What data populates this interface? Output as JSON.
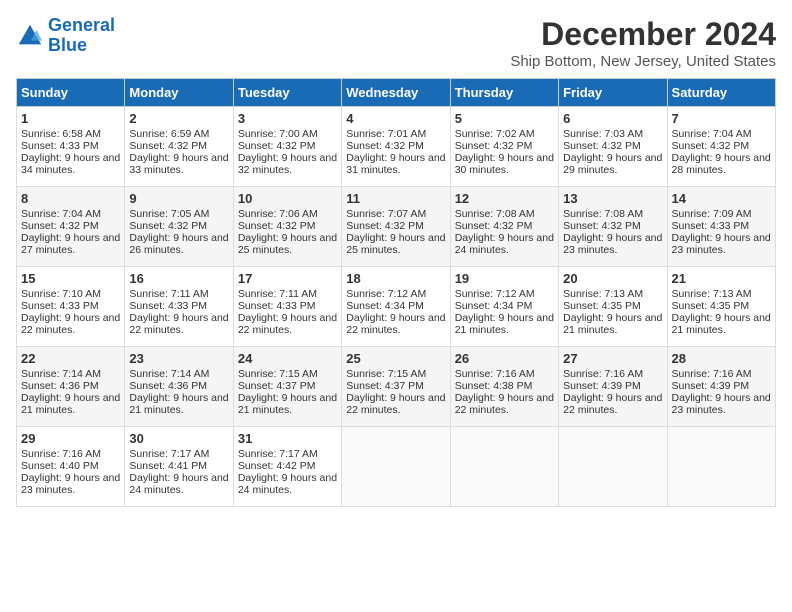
{
  "logo": {
    "line1": "General",
    "line2": "Blue"
  },
  "title": "December 2024",
  "subtitle": "Ship Bottom, New Jersey, United States",
  "days_of_week": [
    "Sunday",
    "Monday",
    "Tuesday",
    "Wednesday",
    "Thursday",
    "Friday",
    "Saturday"
  ],
  "weeks": [
    [
      {
        "day": "1",
        "sunrise": "6:58 AM",
        "sunset": "4:33 PM",
        "daylight": "9 hours and 34 minutes."
      },
      {
        "day": "2",
        "sunrise": "6:59 AM",
        "sunset": "4:32 PM",
        "daylight": "9 hours and 33 minutes."
      },
      {
        "day": "3",
        "sunrise": "7:00 AM",
        "sunset": "4:32 PM",
        "daylight": "9 hours and 32 minutes."
      },
      {
        "day": "4",
        "sunrise": "7:01 AM",
        "sunset": "4:32 PM",
        "daylight": "9 hours and 31 minutes."
      },
      {
        "day": "5",
        "sunrise": "7:02 AM",
        "sunset": "4:32 PM",
        "daylight": "9 hours and 30 minutes."
      },
      {
        "day": "6",
        "sunrise": "7:03 AM",
        "sunset": "4:32 PM",
        "daylight": "9 hours and 29 minutes."
      },
      {
        "day": "7",
        "sunrise": "7:04 AM",
        "sunset": "4:32 PM",
        "daylight": "9 hours and 28 minutes."
      }
    ],
    [
      {
        "day": "8",
        "sunrise": "7:04 AM",
        "sunset": "4:32 PM",
        "daylight": "9 hours and 27 minutes."
      },
      {
        "day": "9",
        "sunrise": "7:05 AM",
        "sunset": "4:32 PM",
        "daylight": "9 hours and 26 minutes."
      },
      {
        "day": "10",
        "sunrise": "7:06 AM",
        "sunset": "4:32 PM",
        "daylight": "9 hours and 25 minutes."
      },
      {
        "day": "11",
        "sunrise": "7:07 AM",
        "sunset": "4:32 PM",
        "daylight": "9 hours and 25 minutes."
      },
      {
        "day": "12",
        "sunrise": "7:08 AM",
        "sunset": "4:32 PM",
        "daylight": "9 hours and 24 minutes."
      },
      {
        "day": "13",
        "sunrise": "7:08 AM",
        "sunset": "4:32 PM",
        "daylight": "9 hours and 23 minutes."
      },
      {
        "day": "14",
        "sunrise": "7:09 AM",
        "sunset": "4:33 PM",
        "daylight": "9 hours and 23 minutes."
      }
    ],
    [
      {
        "day": "15",
        "sunrise": "7:10 AM",
        "sunset": "4:33 PM",
        "daylight": "9 hours and 22 minutes."
      },
      {
        "day": "16",
        "sunrise": "7:11 AM",
        "sunset": "4:33 PM",
        "daylight": "9 hours and 22 minutes."
      },
      {
        "day": "17",
        "sunrise": "7:11 AM",
        "sunset": "4:33 PM",
        "daylight": "9 hours and 22 minutes."
      },
      {
        "day": "18",
        "sunrise": "7:12 AM",
        "sunset": "4:34 PM",
        "daylight": "9 hours and 22 minutes."
      },
      {
        "day": "19",
        "sunrise": "7:12 AM",
        "sunset": "4:34 PM",
        "daylight": "9 hours and 21 minutes."
      },
      {
        "day": "20",
        "sunrise": "7:13 AM",
        "sunset": "4:35 PM",
        "daylight": "9 hours and 21 minutes."
      },
      {
        "day": "21",
        "sunrise": "7:13 AM",
        "sunset": "4:35 PM",
        "daylight": "9 hours and 21 minutes."
      }
    ],
    [
      {
        "day": "22",
        "sunrise": "7:14 AM",
        "sunset": "4:36 PM",
        "daylight": "9 hours and 21 minutes."
      },
      {
        "day": "23",
        "sunrise": "7:14 AM",
        "sunset": "4:36 PM",
        "daylight": "9 hours and 21 minutes."
      },
      {
        "day": "24",
        "sunrise": "7:15 AM",
        "sunset": "4:37 PM",
        "daylight": "9 hours and 21 minutes."
      },
      {
        "day": "25",
        "sunrise": "7:15 AM",
        "sunset": "4:37 PM",
        "daylight": "9 hours and 22 minutes."
      },
      {
        "day": "26",
        "sunrise": "7:16 AM",
        "sunset": "4:38 PM",
        "daylight": "9 hours and 22 minutes."
      },
      {
        "day": "27",
        "sunrise": "7:16 AM",
        "sunset": "4:39 PM",
        "daylight": "9 hours and 22 minutes."
      },
      {
        "day": "28",
        "sunrise": "7:16 AM",
        "sunset": "4:39 PM",
        "daylight": "9 hours and 23 minutes."
      }
    ],
    [
      {
        "day": "29",
        "sunrise": "7:16 AM",
        "sunset": "4:40 PM",
        "daylight": "9 hours and 23 minutes."
      },
      {
        "day": "30",
        "sunrise": "7:17 AM",
        "sunset": "4:41 PM",
        "daylight": "9 hours and 24 minutes."
      },
      {
        "day": "31",
        "sunrise": "7:17 AM",
        "sunset": "4:42 PM",
        "daylight": "9 hours and 24 minutes."
      },
      null,
      null,
      null,
      null
    ]
  ]
}
